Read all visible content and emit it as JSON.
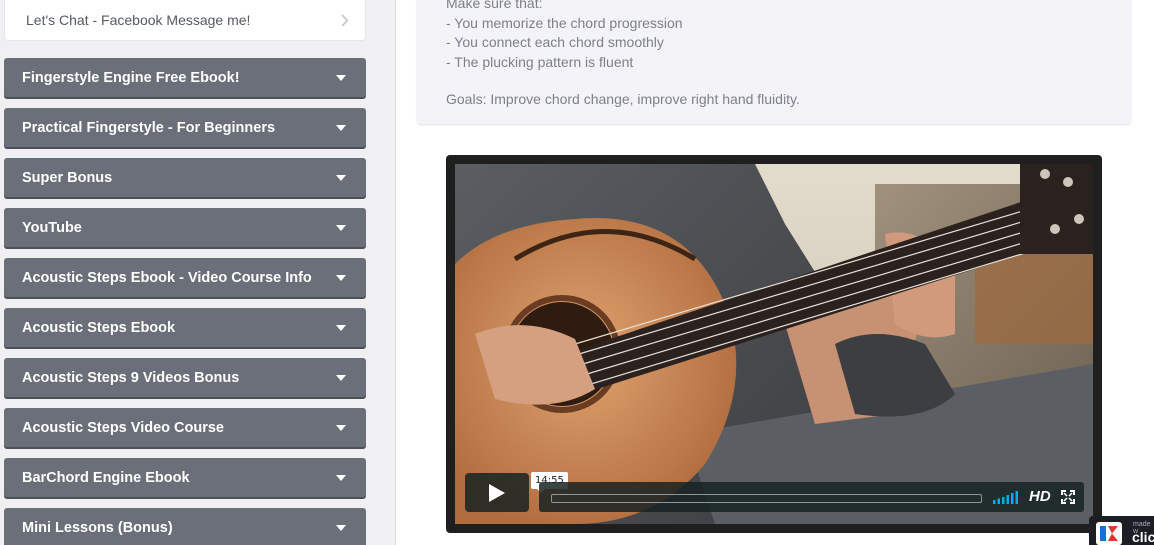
{
  "sidebar": {
    "chat": {
      "label": "Let's Chat - Facebook Message me!"
    },
    "items": [
      {
        "label": "Fingerstyle Engine Free Ebook!"
      },
      {
        "label": "Practical Fingerstyle - For Beginners"
      },
      {
        "label": "Super Bonus"
      },
      {
        "label": "YouTube"
      },
      {
        "label": "Acoustic Steps Ebook - Video Course Info"
      },
      {
        "label": "Acoustic Steps Ebook"
      },
      {
        "label": "Acoustic Steps 9 Videos Bonus"
      },
      {
        "label": "Acoustic Steps Video Course"
      },
      {
        "label": "BarChord Engine Ebook"
      },
      {
        "label": "Mini Lessons (Bonus)"
      }
    ]
  },
  "lesson": {
    "lines": [
      "Make sure that:",
      "- You memorize the chord progression",
      "- You connect each chord smoothly",
      "- The plucking pattern is fluent"
    ],
    "goals": "Goals: Improve chord change, improve right hand fluidity."
  },
  "video": {
    "time": "14:55",
    "hd": "HD",
    "progress": 0,
    "colors": {
      "controls_bg": "#172322",
      "volume_accent": "#00adef"
    }
  },
  "badge": {
    "small": "made w",
    "brand": "clic"
  },
  "icons": [
    "chevron-right-icon",
    "caret-down-icon",
    "play-icon",
    "volume-icon",
    "fullscreen-icon",
    "badge-logo-icon"
  ]
}
